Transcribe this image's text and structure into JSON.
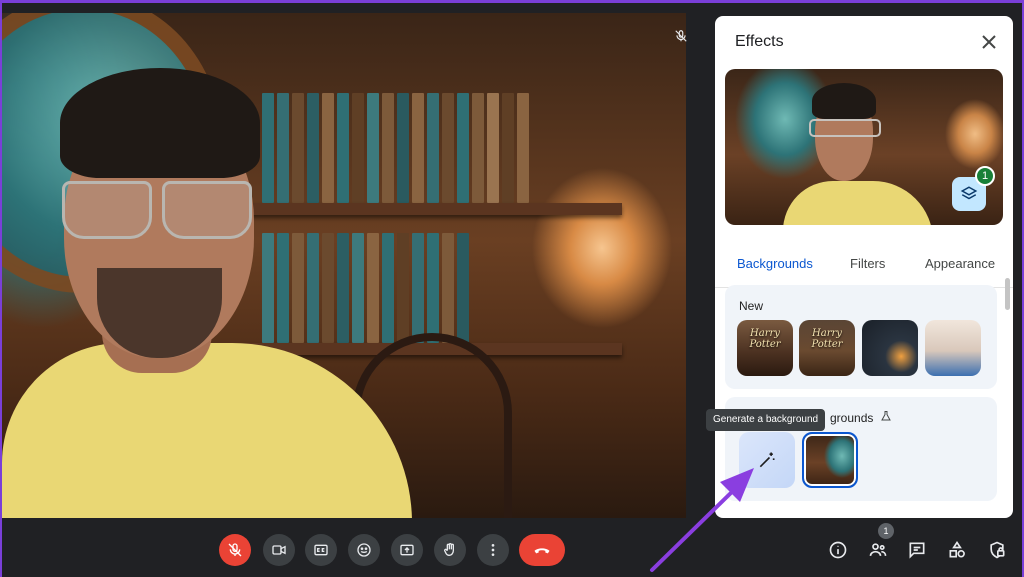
{
  "effects": {
    "title": "Effects",
    "layers_count": "1",
    "tabs": [
      "Backgrounds",
      "Filters",
      "Appearance"
    ],
    "new_section": {
      "title": "New",
      "thumbnails": [
        "Harry Potter",
        "Harry Potter",
        "",
        ""
      ]
    },
    "generated_section": {
      "title_visible": "grounds",
      "tooltip": "Generate a background"
    }
  },
  "bottom_bar": {
    "people_count": "1"
  },
  "colors": {
    "accent": "#0b57d0",
    "danger": "#ea4335",
    "badge_green": "#188038",
    "annotation_arrow": "#8a3ee0"
  },
  "icons": [
    "mic-off-icon",
    "camera-icon",
    "captions-icon",
    "emoji-icon",
    "present-icon",
    "hand-icon",
    "more-icon",
    "end-call-icon",
    "info-icon",
    "people-icon",
    "chat-icon",
    "activities-icon",
    "host-controls-icon",
    "close-icon",
    "layers-icon",
    "magic-wand-icon",
    "beaker-icon"
  ]
}
